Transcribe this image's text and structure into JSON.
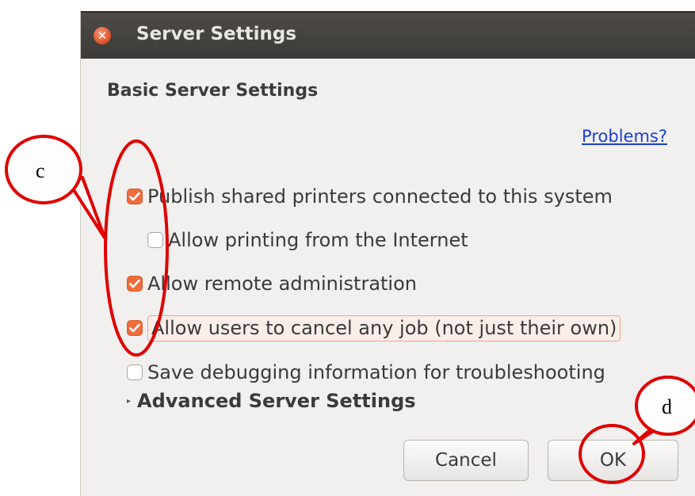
{
  "window": {
    "title": "Server Settings",
    "close_glyph": "✕"
  },
  "section_title": "Basic Server Settings",
  "problems_link": "Problems?",
  "options": [
    {
      "label": "Publish shared printers connected to this system",
      "checked": true
    },
    {
      "label": "Allow printing from the Internet",
      "checked": false
    },
    {
      "label": "Allow remote administration",
      "checked": true
    },
    {
      "label": "Allow users to cancel any job (not just their own)",
      "checked": true,
      "focused": true
    },
    {
      "label": "Save debugging information for troubleshooting",
      "checked": false
    }
  ],
  "advanced": {
    "label": "Advanced Server Settings",
    "arrow": "▸"
  },
  "buttons": {
    "cancel": "Cancel",
    "ok": "OK"
  },
  "annotations": {
    "left_label": "c",
    "right_label": "d"
  },
  "colors": {
    "accent": "#ef6d3d",
    "annotation": "#e00000",
    "link": "#1a3fd6",
    "titlebar": "#3c3b37"
  }
}
